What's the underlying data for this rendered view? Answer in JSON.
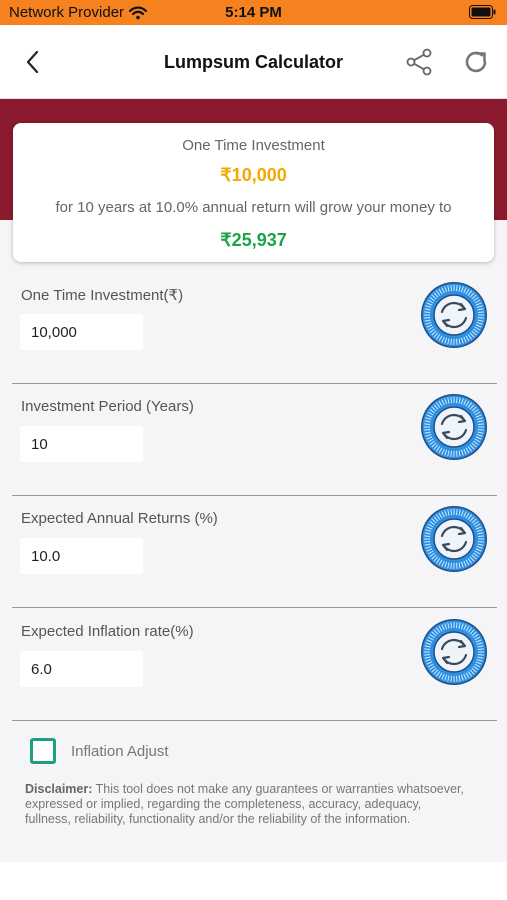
{
  "status_bar": {
    "carrier": "Network Provider",
    "time": "5:14 PM"
  },
  "header": {
    "title": "Lumpsum Calculator"
  },
  "summary": {
    "label": "One Time Investment",
    "amount": "₹10,000",
    "description": "for 10 years at 10.0% annual return will grow your money to",
    "result": "₹25,937"
  },
  "fields": [
    {
      "label": "One Time Investment(₹)",
      "value": "10,000"
    },
    {
      "label": "Investment Period (Years)",
      "value": "10"
    },
    {
      "label": "Expected Annual Returns (%)",
      "value": "10.0"
    },
    {
      "label": "Expected Inflation rate(%)",
      "value": "6.0"
    }
  ],
  "inflation_adjust": {
    "label": "Inflation Adjust",
    "checked": false
  },
  "disclaimer": {
    "prefix": "Disclaimer:",
    "text": " This tool does not make any guarantees or warranties whatsoever, expressed or implied, regarding the completeness, accuracy, adequacy, fullness, reliability, functionality and/or the reliability of the information."
  },
  "colors": {
    "status_bar": "#f5821f",
    "banner": "#8b1a2e",
    "amount": "#f2a900",
    "result": "#1aa34a",
    "dial": "#2e8fe0",
    "checkbox": "#1e9e82"
  },
  "icons": {
    "back": "chevron-left-icon",
    "share": "share-icon",
    "refresh": "refresh-icon",
    "dial": "rotate-dial-icon",
    "wifi": "wifi-icon",
    "battery": "battery-icon"
  }
}
